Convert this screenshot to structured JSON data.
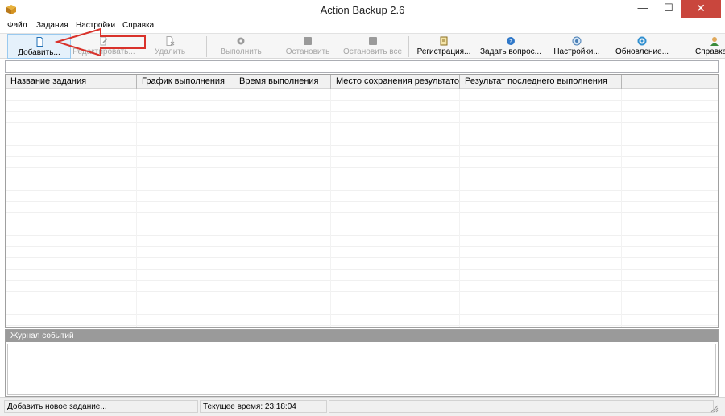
{
  "window": {
    "title": "Action Backup 2.6",
    "minimize_glyph": "—",
    "maximize_glyph": "☐",
    "close_glyph": "✕",
    "app_icon": "box-icon"
  },
  "menu": {
    "items": [
      {
        "label": "Файл"
      },
      {
        "label": "Задания"
      },
      {
        "label": "Настройки"
      },
      {
        "label": "Справка"
      }
    ]
  },
  "toolbar": {
    "buttons": [
      {
        "label": "Добавить...",
        "icon": "document-icon",
        "state": "selected"
      },
      {
        "label": "Редактировать...",
        "icon": "edit-icon",
        "state": "disabled"
      },
      {
        "label": "Удалить",
        "icon": "delete-document-icon",
        "state": "disabled"
      },
      {
        "label": "Выполнить",
        "icon": "gear-icon",
        "state": "disabled"
      },
      {
        "label": "Остановить",
        "icon": "stop-icon",
        "state": "disabled"
      },
      {
        "label": "Остановить все",
        "icon": "stop-all-icon",
        "state": "disabled"
      },
      {
        "label": "Регистрация...",
        "icon": "register-icon",
        "state": "enabled"
      },
      {
        "label": "Задать вопрос...",
        "icon": "help-icon",
        "state": "enabled"
      },
      {
        "label": "Настройки...",
        "icon": "settings-icon",
        "state": "enabled"
      },
      {
        "label": "Обновление...",
        "icon": "update-icon",
        "state": "enabled"
      },
      {
        "label": "Справка",
        "icon": "user-help-icon",
        "state": "enabled"
      }
    ]
  },
  "jobs_table": {
    "columns": [
      {
        "label": "Название задания"
      },
      {
        "label": "График выполнения"
      },
      {
        "label": "Время выполнения"
      },
      {
        "label": "Место сохранения результатов"
      },
      {
        "label": "Результат последнего выполнения"
      }
    ],
    "rows": []
  },
  "log": {
    "title": "Журнал событий",
    "entries": []
  },
  "status": {
    "hint": "Добавить новое задание...",
    "time": "Текущее время: 23:18:04"
  },
  "colors": {
    "annotation_arrow": "#d9322b",
    "close_button": "#c9463d",
    "log_header": "#9a9a9a",
    "selected_button": "#e5f1fb"
  }
}
